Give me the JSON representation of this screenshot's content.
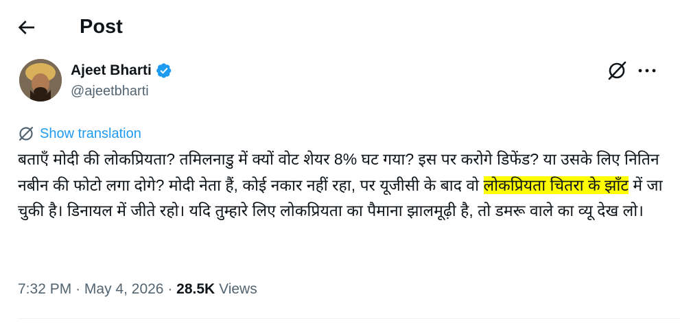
{
  "header": {
    "title": "Post",
    "back_icon": "arrow-left-icon"
  },
  "author": {
    "name": "Ajeet Bharti",
    "handle": "@ajeetbharti",
    "verified": true,
    "verified_color": "#1d9bf0"
  },
  "actions": {
    "grok_icon": "grok-icon",
    "more_icon": "more-horizontal-icon"
  },
  "translation": {
    "label": "Show translation",
    "icon": "translate-icon",
    "color": "#1d9bf0"
  },
  "tweet": {
    "text_before": "बताएँ मोदी की लोकप्रियता? तमिलनाडु में क्यों वोट शेयर 8% घट गया? इस पर करोगे डिफेंड? या उसके लिए नितिन नबीन की फोटो लगा दोगे? मोदी नेता हैं, कोई नकार नहीं रहा, पर यूजीसी के बाद वो ",
    "highlight": "लोकप्रियता चितरा के झाँट",
    "text_after": " में जा चुकी है। डिनायल में जीते रहो। यदि तुम्हारे लिए लोकप्रियता का पैमाना झालमूढ़ी है, तो डमरू वाले का व्यू देख लो।",
    "highlight_color": "#ffff00"
  },
  "meta": {
    "time": "7:32 PM",
    "separator": "·",
    "date": "May 4, 2026",
    "views_count": "28.5K",
    "views_label": "Views"
  }
}
